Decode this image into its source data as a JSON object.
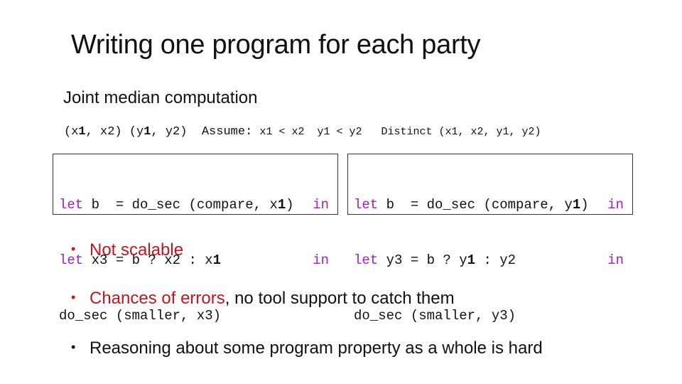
{
  "slide": {
    "title": "Writing one program for each party",
    "subtitle": "Joint median computation",
    "inputs_line": {
      "x_pair_open": "(x",
      "x1_num": "1",
      "x_pair_rest": ", x2)",
      "y_pair_open": " (y",
      "y1_num": "1",
      "y_pair_rest": ", y2)",
      "assume_label": "  Assume: ",
      "assume_x": "x1 < x2",
      "assume_y": "  y1 < y2",
      "distinct": "   Distinct (x1, x2, y1, y2)"
    },
    "code_left": {
      "line1": {
        "kw": "let",
        "text_a": " b  = do_sec (compare, x",
        "bold": "1",
        "text_b": ")",
        "in": "in"
      },
      "line2": {
        "kw": "let",
        "text_a": " x3 = b ? x2 : x",
        "bold": "1",
        "in": "in"
      },
      "line3": {
        "text": "do_sec (smaller, x3)"
      }
    },
    "code_right": {
      "line1": {
        "kw": "let",
        "text_a": " b  = do_sec (compare, y",
        "bold": "1",
        "text_b": ")",
        "in": "in"
      },
      "line2": {
        "kw": "let",
        "text_a": " y3 = b ? y",
        "bold": "1",
        "text_b": " : y2",
        "in": "in"
      },
      "line3": {
        "text": "do_sec (smaller, y3)"
      }
    },
    "bullets": [
      {
        "dot": "•",
        "red_text": "Not scalable",
        "text": ""
      },
      {
        "dot": "•",
        "red_text": "Chances of errors",
        "text": ", no tool support to catch them"
      },
      {
        "dot": "•",
        "red_text": "",
        "text": "Reasoning about some program property as a whole is hard"
      }
    ],
    "colors": {
      "keyword": "#A020C0",
      "emphasis_red": "#C8141E",
      "text": "#111111"
    }
  }
}
